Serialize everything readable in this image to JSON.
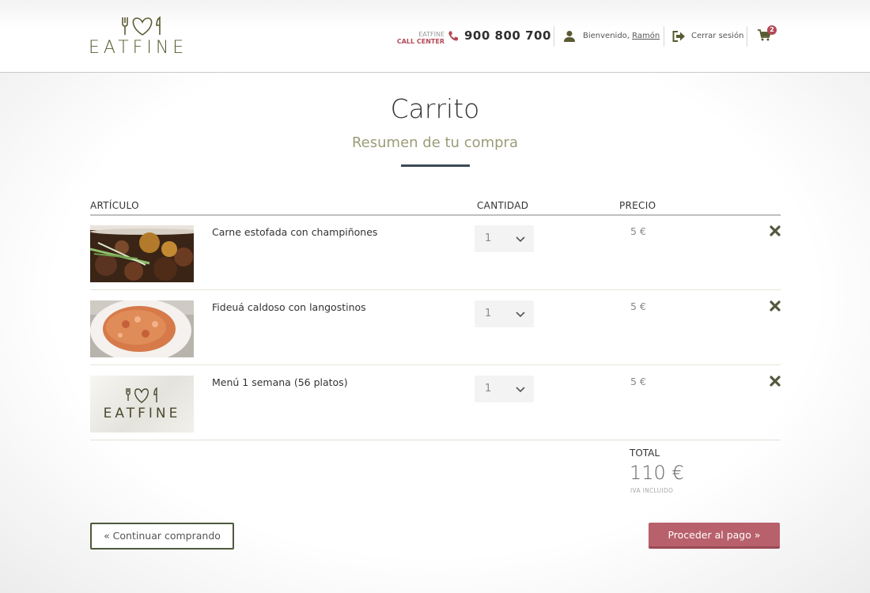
{
  "header": {
    "logo_text": "EATFINE",
    "call_center": {
      "brand": "EATFINE",
      "label": "CALL CENTER",
      "phone": "900 800 700"
    },
    "user": {
      "greeting": "Bienvenido,",
      "name": "Ramón"
    },
    "logout_label": "Cerrar sesión",
    "cart_count": "2"
  },
  "page": {
    "title": "Carrito",
    "subtitle": "Resumen de tu compra"
  },
  "table": {
    "columns": {
      "article": "ARTÍCULO",
      "quantity": "CANTIDAD",
      "price": "PRECIO"
    },
    "rows": [
      {
        "name": "Carne estofada con champiñones",
        "quantity": "1",
        "price": "5 €",
        "thumb": "beef-stew-photo"
      },
      {
        "name": "Fideuá caldoso con langostinos",
        "quantity": "1",
        "price": "5 €",
        "thumb": "fideua-photo"
      },
      {
        "name": "Menú 1 semana (56 platos)",
        "quantity": "1",
        "price": "5 €",
        "thumb": "eatfine-logo-image",
        "thumb_text": "EATFINE"
      }
    ]
  },
  "totals": {
    "label": "TOTAL",
    "value": "110 €",
    "note": "IVA INCLUIDO"
  },
  "actions": {
    "continue_label": "« Continuar comprando",
    "checkout_label": "Proceder al pago »"
  },
  "colors": {
    "brand_olive": "#5a5a32",
    "accent_rose": "#b8606b",
    "divider": "#3d4a56"
  }
}
